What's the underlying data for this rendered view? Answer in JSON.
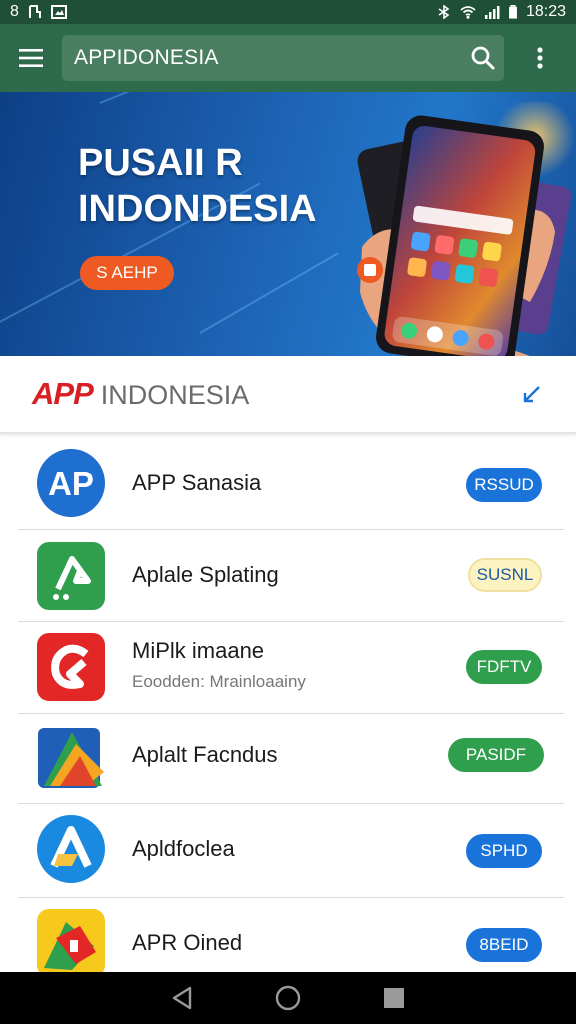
{
  "status_bar": {
    "left_text": "8 ",
    "time": "18:23"
  },
  "app_bar": {
    "search_value": "APPIDONESIA"
  },
  "banner": {
    "title_line1": "PUSAII R",
    "title_line2": "INDONDESIA",
    "cta_label": "S AEHP"
  },
  "section": {
    "logo": "APP",
    "name": "INDONESIA"
  },
  "apps": [
    {
      "name": "APP Sanasia",
      "subtitle": "",
      "button": "RSSUD",
      "button_style": "blue-pill"
    },
    {
      "name": "Aplale Splating",
      "subtitle": "",
      "button": "SUSNL",
      "button_style": "cream-pill"
    },
    {
      "name": "MiPlk imaane",
      "subtitle": "Eoodden: Mrainloaainy",
      "button": "FDFTV",
      "button_style": "green-pill"
    },
    {
      "name": "Aplalt Facndus",
      "subtitle": "",
      "button": "PASIDF",
      "button_style": "green-pill-wide"
    },
    {
      "name": "Apldfoclea",
      "subtitle": "",
      "button": "SPHD",
      "button_style": "blue-pill"
    },
    {
      "name": "APR Oined",
      "subtitle": "",
      "button": "8BEID",
      "button_style": "blue-pill"
    }
  ],
  "colors": {
    "status_bar": "#1f4f37",
    "app_bar": "#2e6b4c",
    "accent_orange": "#ef5a22",
    "pill_blue": "#1a73d9",
    "pill_green": "#2f9e4d",
    "pill_cream": "#fdf3c0"
  },
  "icons": {
    "menu": "hamburger-icon",
    "search": "search-icon",
    "more": "more-vert-icon",
    "collapse": "collapse-icon",
    "nav_back": "back-triangle-icon",
    "nav_home": "home-circle-icon",
    "nav_recents": "recents-square-icon"
  }
}
